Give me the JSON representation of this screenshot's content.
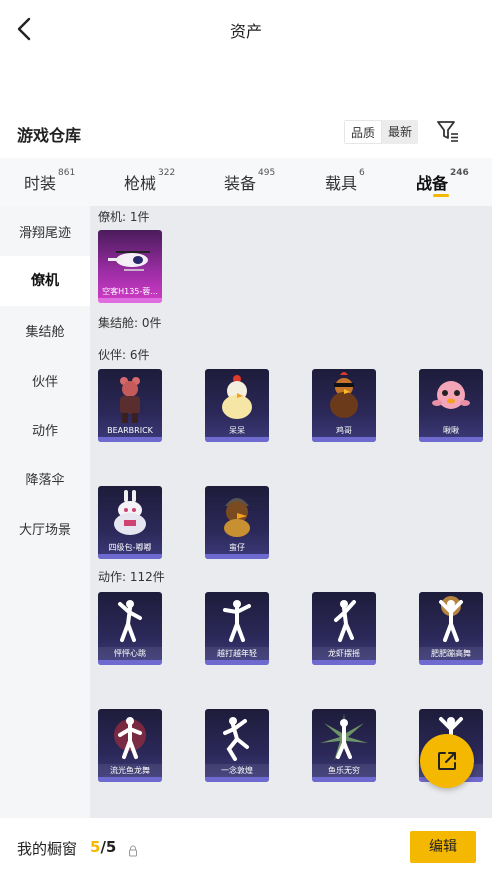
{
  "header": {
    "title": "资产"
  },
  "warehouse": {
    "title": "游戏仓库",
    "sort_options": [
      "品质",
      "最新"
    ]
  },
  "tabs": [
    {
      "label": "时装",
      "count": "861"
    },
    {
      "label": "枪械",
      "count": "322"
    },
    {
      "label": "装备",
      "count": "495"
    },
    {
      "label": "载具",
      "count": "6"
    },
    {
      "label": "战备",
      "count": "246"
    }
  ],
  "sidebar": {
    "items": [
      "滑翔尾迹",
      "僚机",
      "集结舱",
      "伙伴",
      "动作",
      "降落伞",
      "大厅场景"
    ]
  },
  "sections": {
    "wingman": {
      "label": "僚机: 1件",
      "items": [
        "空客H135-蓉..."
      ]
    },
    "pod": {
      "label": "集结舱: 0件"
    },
    "partner": {
      "label": "伙伴: 6件",
      "items": [
        "BEARBRICK",
        "呆呆",
        "鸡哥",
        "啾啾",
        "四级包-嘟嘟",
        "蛮仔"
      ]
    },
    "emote": {
      "label": "动作: 112件",
      "items": [
        "怦怦心跳",
        "越打越年轻",
        "龙虾摆摇",
        "肥肥蹦高舞",
        "流光鱼龙舞",
        "一念敦煌",
        "鱼乐无穷",
        ""
      ]
    }
  },
  "footer": {
    "label": "我的橱窗",
    "count_num": "5",
    "count_den": "/5",
    "edit_label": "编辑"
  },
  "colors": {
    "accent": "#f5b800",
    "card_bg": "#2b2858",
    "card_pink": "#c23ab8"
  }
}
